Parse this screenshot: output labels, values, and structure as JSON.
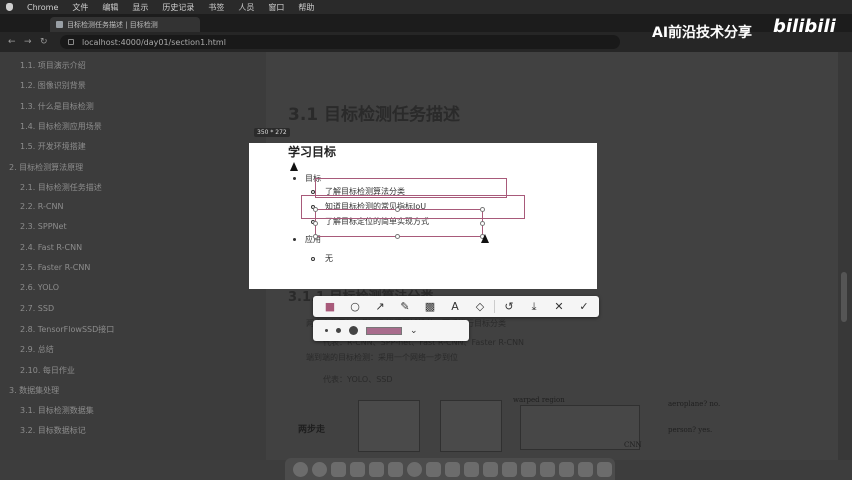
{
  "menubar": {
    "app": "Chrome",
    "items": [
      "文件",
      "编辑",
      "显示",
      "历史记录",
      "书签",
      "人员",
      "窗口",
      "帮助"
    ]
  },
  "browser": {
    "tab_title": "目标检测任务描述 | 目标检测",
    "url": "localhost:4000/day01/section1.html",
    "back": "←",
    "forward": "→",
    "reload": "↻"
  },
  "watermark": {
    "text": "AI前沿技术分享",
    "logo": "bilibili"
  },
  "sidebar": {
    "items": [
      {
        "label": "1.1. 项目演示介绍"
      },
      {
        "label": "1.2. 图像识别背景"
      },
      {
        "label": "1.3. 什么是目标检测"
      },
      {
        "label": "1.4. 目标检测应用场景"
      },
      {
        "label": "1.5. 开发环境搭建"
      },
      {
        "label": "2. 目标检测算法原理"
      },
      {
        "label": "2.1. 目标检测任务描述"
      },
      {
        "label": "2.2. R-CNN"
      },
      {
        "label": "2.3. SPPNet"
      },
      {
        "label": "2.4. Fast R-CNN"
      },
      {
        "label": "2.5. Faster R-CNN"
      },
      {
        "label": "2.6. YOLO"
      },
      {
        "label": "2.7. SSD"
      },
      {
        "label": "2.8. TensorFlowSSD接口"
      },
      {
        "label": "2.9. 总结"
      },
      {
        "label": "2.10. 每日作业"
      },
      {
        "label": "3. 数据集处理"
      },
      {
        "label": "3.1. 目标检测数据集"
      },
      {
        "label": "3.2. 目标数据标记"
      }
    ]
  },
  "doc": {
    "title": "3.1 目标检测任务描述",
    "section_heading": "3.1.1 目标检测算法分类",
    "bullet_two_stage": "两步走的目标检测：先进行区域推荐，而后进行目标分类",
    "bullet_two_stage_examples": "代表：R-CNN、SPP-net、Fast R-CNN、Faster R-CNN",
    "bullet_one_stage": "端到端的目标检测：采用一个网络一步到位",
    "bullet_one_stage_examples": "代表：YOLO、SSD",
    "figure_label": "两步走",
    "figure_warped": "warped region",
    "figure_labels": [
      "aeroplane? no.",
      "person? yes.",
      "CNN"
    ]
  },
  "capture": {
    "size_label": "350 * 272",
    "heading": "学习目标",
    "goal_label": "目标",
    "goals": [
      "了解目标检测算法分类",
      "知道目标检测的常见指标IoU",
      "了解目标定位的简单实现方式"
    ],
    "apply_label": "应用",
    "apply_items": [
      "无"
    ]
  },
  "toolbar": {
    "tools": [
      {
        "name": "rectangle-tool-icon",
        "glyph": "■"
      },
      {
        "name": "ellipse-tool-icon",
        "glyph": "○"
      },
      {
        "name": "arrow-tool-icon",
        "glyph": "↗"
      },
      {
        "name": "pen-tool-icon",
        "glyph": "✎"
      },
      {
        "name": "mosaic-tool-icon",
        "glyph": "▩"
      },
      {
        "name": "text-tool-icon",
        "glyph": "A"
      },
      {
        "name": "eraser-tool-icon",
        "glyph": "◇"
      },
      {
        "name": "undo-icon",
        "glyph": "↺"
      },
      {
        "name": "download-icon",
        "glyph": "⤓"
      },
      {
        "name": "close-icon",
        "glyph": "✕"
      },
      {
        "name": "confirm-icon",
        "glyph": "✓"
      }
    ],
    "colors": {
      "annotation": "#a85a7a"
    }
  }
}
